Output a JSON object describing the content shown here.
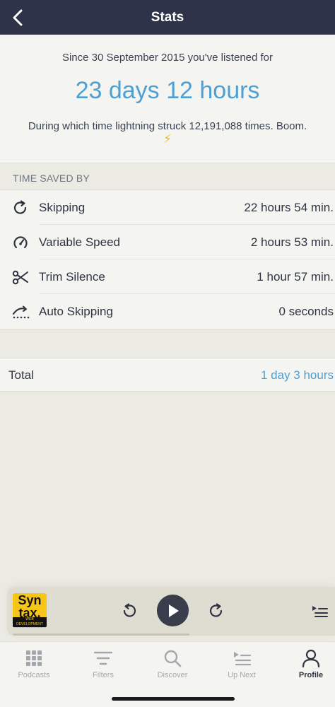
{
  "header": {
    "title": "Stats"
  },
  "summary": {
    "since_text": "Since 30 September 2015 you've listened for",
    "total_listened": "23 days 12 hours",
    "fun_fact": "During which time lightning struck 12,191,088 times. Boom.",
    "fun_icon": "⚡"
  },
  "time_saved": {
    "header": "TIME SAVED BY",
    "items": [
      {
        "label": "Skipping",
        "value": "22 hours 54 min.",
        "icon": "skip-icon"
      },
      {
        "label": "Variable Speed",
        "value": "2 hours 53 min.",
        "icon": "speed-gauge-icon"
      },
      {
        "label": "Trim Silence",
        "value": "1 hour 57 min.",
        "icon": "scissors-icon"
      },
      {
        "label": "Auto Skipping",
        "value": "0 seconds",
        "icon": "auto-skip-icon"
      }
    ]
  },
  "total": {
    "label": "Total",
    "value": "1 day 3 hours"
  },
  "mini_player": {
    "artwork": {
      "line1": "Syn",
      "line2": "tax.",
      "line3": "WEB DEVELOPMENT"
    },
    "progress": 0.55
  },
  "tabs": [
    {
      "label": "Podcasts",
      "icon": "grid-icon",
      "active": false
    },
    {
      "label": "Filters",
      "icon": "filters-icon",
      "active": false
    },
    {
      "label": "Discover",
      "icon": "search-icon",
      "active": false
    },
    {
      "label": "Up Next",
      "icon": "up-next-icon",
      "active": false
    },
    {
      "label": "Profile",
      "icon": "profile-icon",
      "active": true
    }
  ],
  "colors": {
    "accent": "#4e9fd4",
    "header_bg": "#2f3349",
    "bolt": "#f3b823"
  }
}
